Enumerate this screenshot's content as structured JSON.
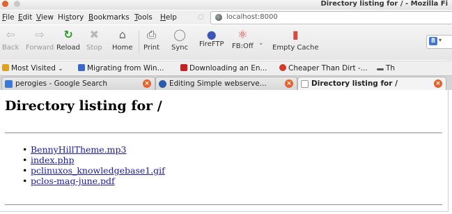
{
  "window": {
    "title": "Directory listing for / - Mozilla Fi"
  },
  "menubar": {
    "items": [
      {
        "prefix": "",
        "key": "F",
        "rest": "ile"
      },
      {
        "prefix": "",
        "key": "E",
        "rest": "dit"
      },
      {
        "prefix": "",
        "key": "V",
        "rest": "iew"
      },
      {
        "prefix": "Hi",
        "key": "s",
        "rest": "tory"
      },
      {
        "prefix": "",
        "key": "B",
        "rest": "ookmarks"
      },
      {
        "prefix": "",
        "key": "T",
        "rest": "ools"
      },
      {
        "prefix": "",
        "key": "H",
        "rest": "elp"
      }
    ],
    "url": "localhost:8000"
  },
  "toolbar": {
    "back": "Back",
    "forward": "Forward",
    "reload": "Reload",
    "stop": "Stop",
    "home": "Home",
    "print": "Print",
    "sync": "Sync",
    "fireftp": "FireFTP",
    "fboff": "FB:Off",
    "empty_cache": "Empty Cache"
  },
  "bookmarks": {
    "most_visited": "Most Visited",
    "items": [
      "Migrating from Win...",
      "Downloading an En...",
      "Cheaper Than Dirt -...",
      "Th"
    ]
  },
  "tabs": [
    {
      "label": "perogies - Google Search"
    },
    {
      "label": "Editing Simple webserve..."
    },
    {
      "label": "Directory listing for /"
    }
  ],
  "page": {
    "heading": "Directory listing for /",
    "files": [
      "BennyHillTheme.mp3",
      "index.php",
      "pclinuxos_knowledgebase1.gif",
      "pclos-mag-june.pdf"
    ]
  },
  "colors": {
    "link": "#1a1aa6",
    "close_accent": "#e4632a"
  }
}
